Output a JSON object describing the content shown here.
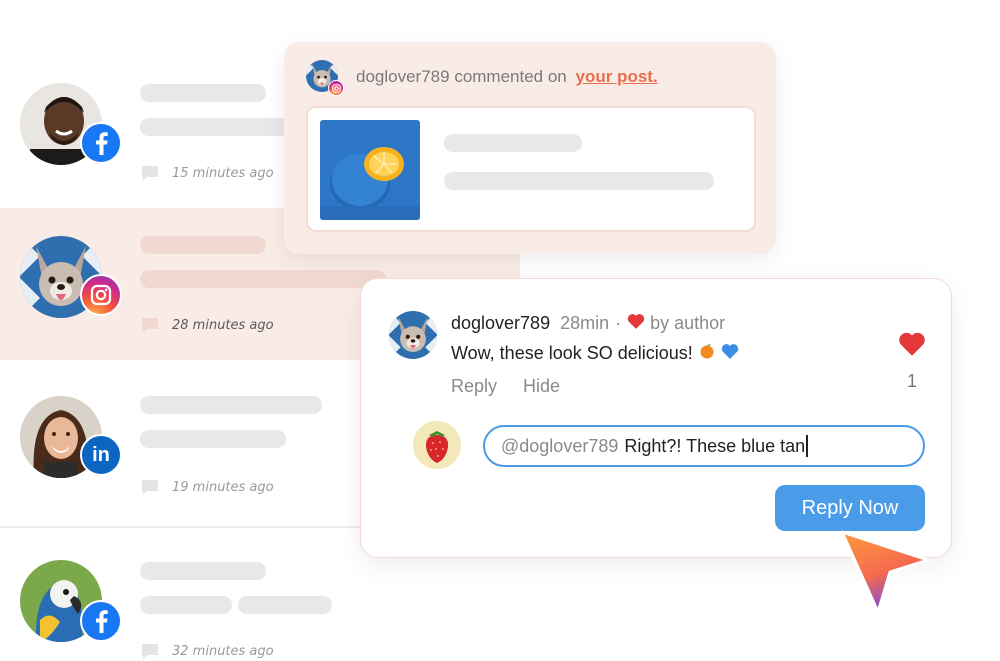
{
  "feed": {
    "items": [
      {
        "time": "15 minutes ago",
        "network": "facebook",
        "avatar": "smiling-man-avatar"
      },
      {
        "time": "28 minutes ago",
        "network": "instagram",
        "avatar": "french-bulldog-avatar",
        "highlighted": true
      },
      {
        "time": "19 minutes ago",
        "network": "linkedin",
        "avatar": "smiling-woman-avatar"
      },
      {
        "time": "32 minutes ago",
        "network": "facebook",
        "avatar": "macaw-parrot-avatar"
      }
    ]
  },
  "notification": {
    "username": "doglover789",
    "action": "commented on",
    "link_text": "your post.",
    "network": "instagram"
  },
  "comment": {
    "username": "doglover789",
    "age": "28min",
    "separator": "·",
    "liked_by": "by author",
    "text": "Wow, these look SO delicious!",
    "emojis": [
      "orange-emoji",
      "blue-heart-emoji"
    ],
    "actions": {
      "reply": "Reply",
      "hide": "Hide"
    },
    "likes": "1"
  },
  "reply": {
    "mention": "@doglover789",
    "draft": "Right?! These blue tan",
    "button_label": "Reply Now"
  },
  "colors": {
    "accent_link": "#e66f4e",
    "button_blue": "#4a9ce8",
    "highlight_bg": "#f9ece7",
    "heart_red": "#e5383b",
    "facebook_blue": "#1877f2",
    "linkedin_blue": "#0a66c2"
  }
}
